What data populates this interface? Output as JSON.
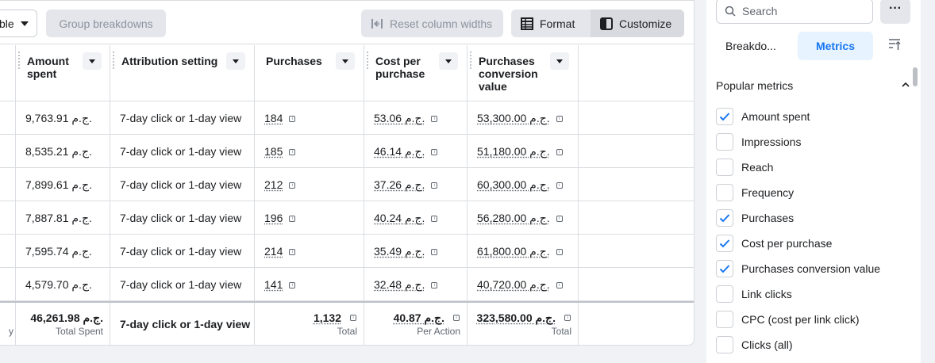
{
  "toolbar": {
    "select_label": "ble",
    "group_label": "Group breakdowns",
    "reset_label": "Reset column widths",
    "format_label": "Format",
    "customize_label": "Customize"
  },
  "columns": {
    "amount": "Amount\nspent",
    "attribution": "Attribution setting",
    "purchases": "Purchases",
    "cost": "Cost per\npurchase",
    "value": "Purchases\nconversion\nvalue"
  },
  "rows": [
    {
      "amount": "9,763.91 ج.م.",
      "attribution": "7-day click or 1-day view",
      "purchases": "184",
      "cost": "53.06 ج.م.",
      "value": "53,300.00 ج.م."
    },
    {
      "amount": "8,535.21 ج.م.",
      "attribution": "7-day click or 1-day view",
      "purchases": "185",
      "cost": "46.14 ج.م.",
      "value": "51,180.00 ج.م."
    },
    {
      "amount": "7,899.61 ج.م.",
      "attribution": "7-day click or 1-day view",
      "purchases": "212",
      "cost": "37.26 ج.م.",
      "value": "60,300.00 ج.م."
    },
    {
      "amount": "7,887.81 ج.م.",
      "attribution": "7-day click or 1-day view",
      "purchases": "196",
      "cost": "40.24 ج.م.",
      "value": "56,280.00 ج.م."
    },
    {
      "amount": "7,595.74 ج.م.",
      "attribution": "7-day click or 1-day view",
      "purchases": "214",
      "cost": "35.49 ج.م.",
      "value": "61,800.00 ج.م."
    },
    {
      "amount": "4,579.70 ج.م.",
      "attribution": "7-day click or 1-day view",
      "purchases": "141",
      "cost": "32.48 ج.م.",
      "value": "40,720.00 ج.م."
    }
  ],
  "totals": {
    "left_fragment": "y",
    "amount": "46,261.98 ج.م.",
    "amount_label": "Total Spent",
    "attribution": "7-day click or 1-day view",
    "purchases": "1,132",
    "purchases_label": "Total",
    "cost": "40.87 ج.م.",
    "cost_label": "Per Action",
    "value": "323,580.00 ج.م.",
    "value_label": "Total"
  },
  "side": {
    "search_placeholder": "Search",
    "more_label": "···",
    "tab_breakdown": "Breakdo...",
    "tab_metrics": "Metrics",
    "section_title": "Popular metrics",
    "metrics": [
      {
        "label": "Amount spent",
        "checked": true
      },
      {
        "label": "Impressions",
        "checked": false
      },
      {
        "label": "Reach",
        "checked": false
      },
      {
        "label": "Frequency",
        "checked": false
      },
      {
        "label": "Purchases",
        "checked": true
      },
      {
        "label": "Cost per purchase",
        "checked": true
      },
      {
        "label": "Purchases conversion value",
        "checked": true
      },
      {
        "label": "Link clicks",
        "checked": false
      },
      {
        "label": "CPC (cost per link click)",
        "checked": false
      },
      {
        "label": "Clicks (all)",
        "checked": false
      }
    ]
  },
  "colors": {
    "accent": "#1877f2",
    "check": "#1877f2"
  }
}
